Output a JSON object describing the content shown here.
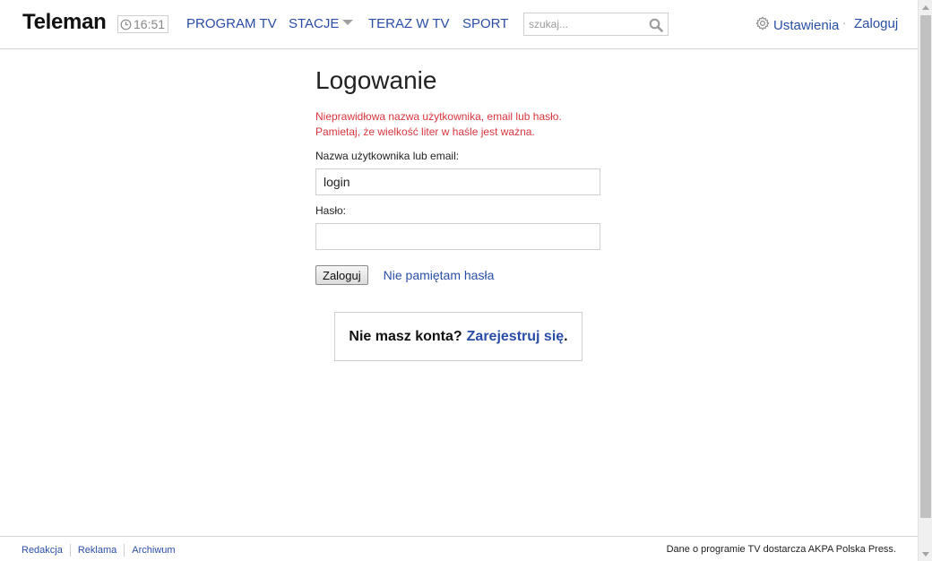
{
  "header": {
    "logo": "Teleman",
    "clock_time": "16:51",
    "nav": [
      {
        "label": "PROGRAM TV"
      },
      {
        "label": "STACJE"
      },
      {
        "label": "TERAZ W TV"
      },
      {
        "label": "SPORT"
      }
    ],
    "search": {
      "placeholder": "szukaj...",
      "value": ""
    },
    "settings_label": "Ustawienia",
    "separator": "·",
    "login_label": "Zaloguj"
  },
  "login": {
    "title": "Logowanie",
    "error_line1": "Nieprawidłowa nazwa użytkownika, email lub hasło.",
    "error_line2": "Pamietaj, że wielkość liter w haśle jest ważna.",
    "username_label": "Nazwa użytkownika lub email:",
    "username_value": "login",
    "password_label": "Hasło:",
    "password_value": "",
    "submit_label": "Zaloguj",
    "forgot_label": "Nie pamiętam hasła"
  },
  "register": {
    "prompt": "Nie masz konta?",
    "link_label": "Zarejestruj się",
    "suffix": "."
  },
  "footer": {
    "links": [
      {
        "label": "Redakcja"
      },
      {
        "label": "Reklama"
      },
      {
        "label": "Archiwum"
      }
    ],
    "credit": "Dane o programie TV dostarcza AKPA Polska Press."
  },
  "colors": {
    "link": "#2a4ea6",
    "error": "#d9363e",
    "border": "#cfcfcf"
  }
}
